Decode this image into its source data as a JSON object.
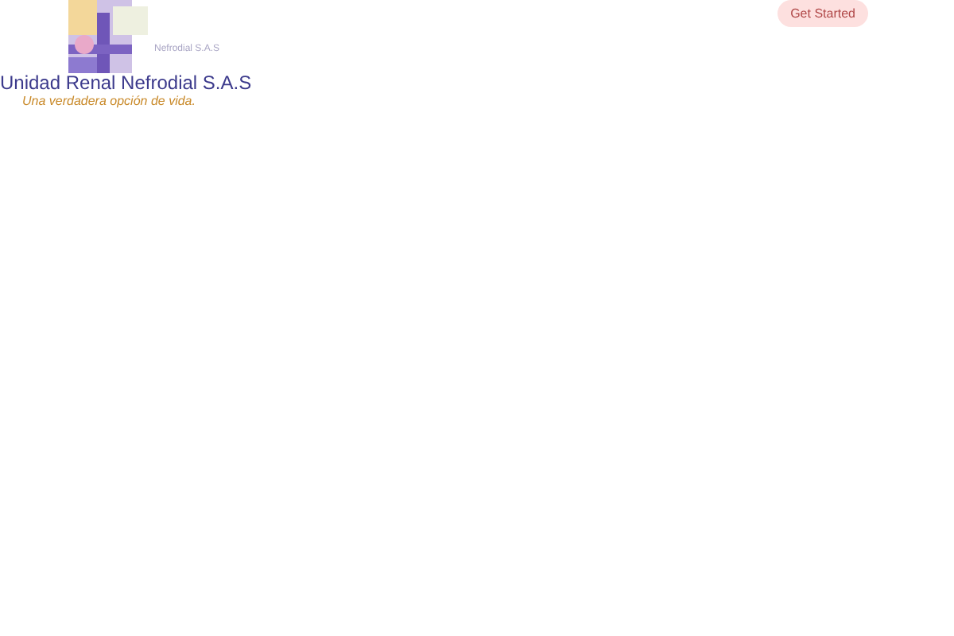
{
  "logo": {
    "mark_caption": "Nefrodial S.A.S",
    "name": "Unidad Renal  Nefrodial S.A.S",
    "tagline": "Una verdadera opción de vida."
  },
  "header_button": {
    "label": "Get Started"
  }
}
